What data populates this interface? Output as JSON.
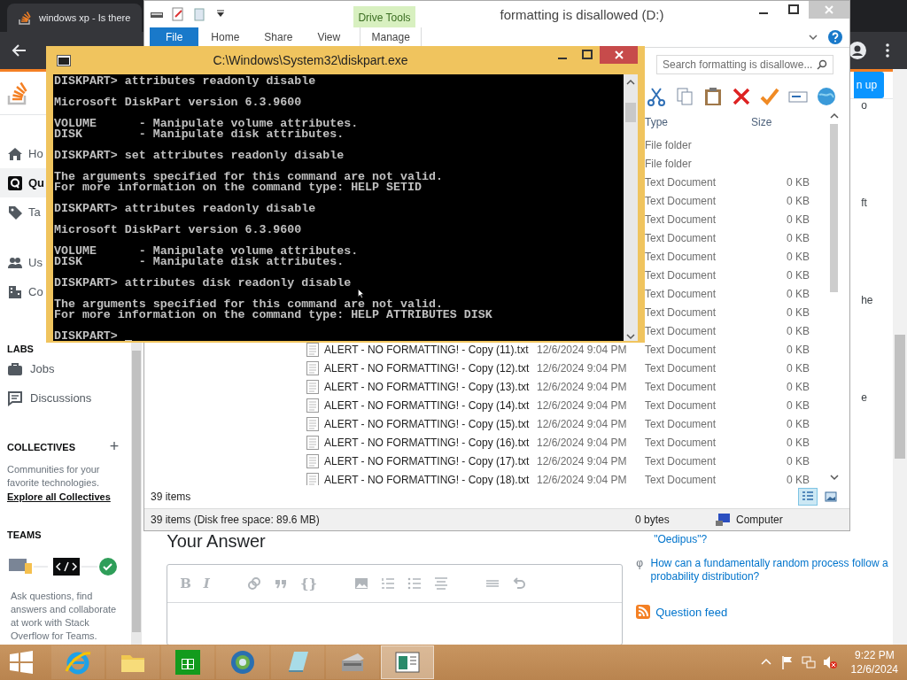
{
  "browser": {
    "tab_title": "windows xp - Is there",
    "signup_button": "n up"
  },
  "sidebar": {
    "nav": [
      {
        "label": "Ho",
        "kind": "home",
        "selected": false
      },
      {
        "label": "Qu",
        "kind": "questions",
        "selected": true
      },
      {
        "label": "Ta",
        "kind": "tags",
        "selected": false
      },
      {
        "label": "Us",
        "kind": "users",
        "selected": false
      },
      {
        "label": "Co",
        "kind": "companies",
        "selected": false
      }
    ],
    "labs_heading": "LABS",
    "labs": [
      {
        "label": "Jobs",
        "kind": "jobs"
      },
      {
        "label": "Discussions",
        "kind": "discussions"
      }
    ],
    "collectives": {
      "heading": "COLLECTIVES",
      "add": "+",
      "text": "Communities for your favorite technologies.",
      "link": "Explore all Collectives"
    },
    "teams": {
      "heading": "TEAMS",
      "text": "Ask questions, find answers and collaborate at work with Stack Overflow for Teams."
    }
  },
  "answer": {
    "heading": "Your Answer",
    "text_buttons": [
      "B",
      "I"
    ],
    "code_button": "{}"
  },
  "related": {
    "fragments": [
      "o",
      "ft",
      "he",
      "e"
    ],
    "links": [
      {
        "text": "\"Oedipus\"?"
      },
      {
        "text": "How can a fundamentally random process follow a probability distribution?",
        "site_icon": "φ"
      }
    ],
    "feed": "Question feed"
  },
  "explorer": {
    "title": "formatting is disallowed (D:)",
    "context_tab": "Drive Tools",
    "tabs": [
      {
        "label": "File",
        "selected": true
      },
      {
        "label": "Home",
        "selected": false
      },
      {
        "label": "Share",
        "selected": false
      },
      {
        "label": "View",
        "selected": false
      },
      {
        "label": "Manage",
        "selected": false
      }
    ],
    "search": {
      "placeholder": "Search formatting is disallowe..."
    },
    "columns": [
      "Type",
      "Size"
    ],
    "rows": [
      {
        "type": "File folder"
      },
      {
        "type": "File folder"
      },
      {
        "type": "Text Document",
        "size": "0 KB"
      },
      {
        "type": "Text Document",
        "size": "0 KB"
      },
      {
        "type": "Text Document",
        "size": "0 KB"
      },
      {
        "type": "Text Document",
        "size": "0 KB"
      },
      {
        "type": "Text Document",
        "size": "0 KB"
      },
      {
        "type": "Text Document",
        "size": "0 KB"
      },
      {
        "type": "Text Document",
        "size": "0 KB"
      },
      {
        "type": "Text Document",
        "size": "0 KB"
      },
      {
        "type": "Text Document",
        "size": "0 KB"
      },
      {
        "name": "ALERT - NO FORMATTING! - Copy (11).txt",
        "date": "12/6/2024 9:04 PM",
        "type": "Text Document",
        "size": "0 KB"
      },
      {
        "name": "ALERT - NO FORMATTING! - Copy (12).txt",
        "date": "12/6/2024 9:04 PM",
        "type": "Text Document",
        "size": "0 KB"
      },
      {
        "name": "ALERT - NO FORMATTING! - Copy (13).txt",
        "date": "12/6/2024 9:04 PM",
        "type": "Text Document",
        "size": "0 KB"
      },
      {
        "name": "ALERT - NO FORMATTING! - Copy (14).txt",
        "date": "12/6/2024 9:04 PM",
        "type": "Text Document",
        "size": "0 KB"
      },
      {
        "name": "ALERT - NO FORMATTING! - Copy (15).txt",
        "date": "12/6/2024 9:04 PM",
        "type": "Text Document",
        "size": "0 KB"
      },
      {
        "name": "ALERT - NO FORMATTING! - Copy (16).txt",
        "date": "12/6/2024 9:04 PM",
        "type": "Text Document",
        "size": "0 KB"
      },
      {
        "name": "ALERT - NO FORMATTING! - Copy (17).txt",
        "date": "12/6/2024 9:04 PM",
        "type": "Text Document",
        "size": "0 KB"
      },
      {
        "name": "ALERT - NO FORMATTING! - Copy (18).txt",
        "date": "12/6/2024 9:04 PM",
        "type": "Text Document",
        "size": "0 KB"
      }
    ],
    "item_count": "39 items",
    "status": {
      "summary": "39 items (Disk free space: 89.6 MB)",
      "size": "0 bytes",
      "location": "Computer"
    }
  },
  "console": {
    "title": "C:\\Windows\\System32\\diskpart.exe",
    "blocks": [
      [
        "DISKPART> attributes readonly disable"
      ],
      [
        "Microsoft DiskPart version 6.3.9600"
      ],
      [
        "VOLUME      - Manipulate volume attributes.",
        "DISK        - Manipulate disk attributes."
      ],
      [
        "DISKPART> set attributes readonly disable"
      ],
      [
        "The arguments specified for this command are not valid.",
        "For more information on the command type: HELP SETID"
      ],
      [
        "DISKPART> attributes readonly disable"
      ],
      [
        "Microsoft DiskPart version 6.3.9600"
      ],
      [
        "VOLUME      - Manipulate volume attributes.",
        "DISK        - Manipulate disk attributes."
      ],
      [
        "DISKPART> attributes disk readonly disable"
      ],
      [
        "The arguments specified for this command are not valid.",
        "For more information on the command type: HELP ATTRIBUTES DISK"
      ],
      [
        "DISKPART> "
      ]
    ]
  },
  "taskbar": {
    "apps": [
      {
        "kind": "ie",
        "selected": false
      },
      {
        "kind": "folder",
        "selected": false
      },
      {
        "kind": "store",
        "selected": false
      },
      {
        "kind": "globe",
        "selected": false
      },
      {
        "kind": "notepad",
        "selected": false
      },
      {
        "kind": "scanner",
        "selected": false
      },
      {
        "kind": "window",
        "selected": true
      }
    ],
    "time": "9:22 PM",
    "date": "12/6/2024"
  }
}
